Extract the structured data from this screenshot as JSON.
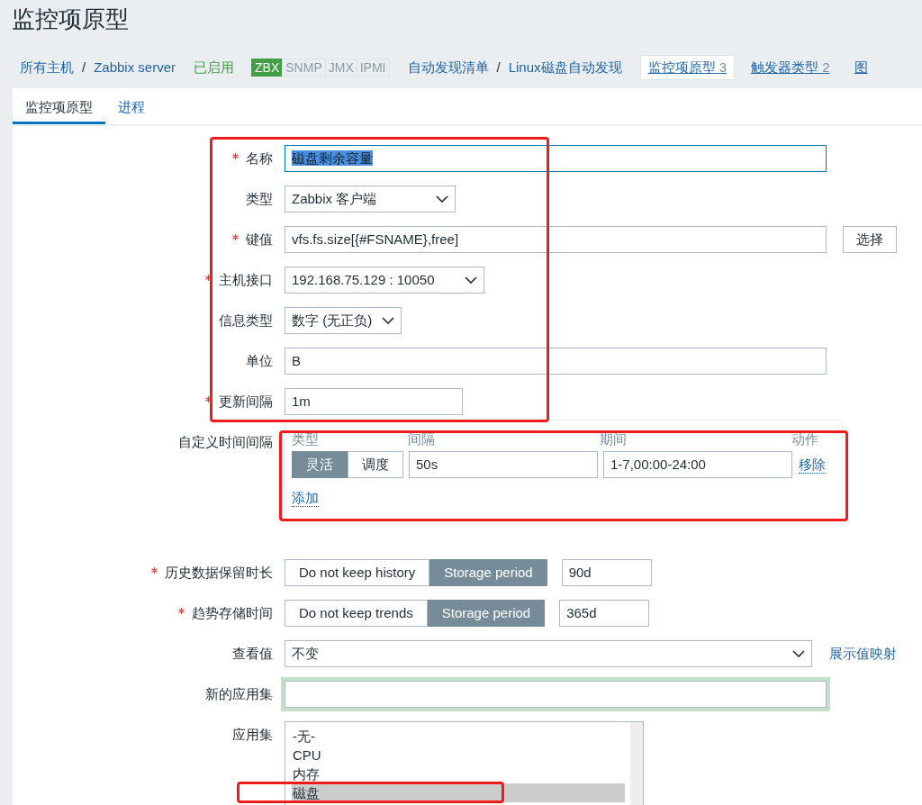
{
  "page_title": "监控项原型",
  "nav": {
    "host_crumbs": {
      "items": [
        {
          "label": "所有主机"
        },
        {
          "label": "Zabbix server"
        }
      ],
      "separator": "/"
    },
    "status": "已启用",
    "availability": [
      {
        "label": "ZBX",
        "on": true
      },
      {
        "label": "SNMP",
        "on": false
      },
      {
        "label": "JMX",
        "on": false
      },
      {
        "label": "IPMI",
        "on": false
      }
    ],
    "discovery_crumbs": {
      "items": [
        {
          "label": "自动发现清单"
        },
        {
          "label": "Linux磁盘自动发现"
        }
      ],
      "separator": "/"
    },
    "tabs": [
      {
        "label": "监控项原型",
        "count": "3",
        "selected": true
      },
      {
        "label": "触发器类型",
        "count": "2",
        "selected": false
      },
      {
        "label": "图",
        "selected": false
      }
    ]
  },
  "form_tabs": [
    {
      "label": "监控项原型",
      "selected": true
    },
    {
      "label": "进程",
      "selected": false
    }
  ],
  "fields": [
    {
      "kind": "text",
      "label": "名称",
      "required": true,
      "value": "磁盘剩余容量",
      "focused": true,
      "text_selected": true
    },
    {
      "kind": "select",
      "label": "类型",
      "required": false,
      "value": "Zabbix 客户端"
    },
    {
      "kind": "text_button",
      "label": "键值",
      "required": true,
      "value": "vfs.fs.size[{#FSNAME},free]",
      "button": "选择"
    },
    {
      "kind": "select",
      "label": "主机接口",
      "required": true,
      "value": "192.168.75.129 : 10050"
    },
    {
      "kind": "select",
      "label": "信息类型",
      "required": false,
      "value": "数字 (无正负)"
    },
    {
      "kind": "text",
      "label": "单位",
      "required": false,
      "value": "B"
    },
    {
      "kind": "text",
      "label": "更新间隔",
      "required": true,
      "value": "1m"
    },
    {
      "kind": "intervals",
      "label": "自定义时间间隔",
      "required": false,
      "columns": [
        "类型",
        "间隔",
        "期间",
        "动作"
      ],
      "rows": [
        {
          "modes": [
            {
              "label": "灵活",
              "selected": true
            },
            {
              "label": "调度",
              "selected": false
            }
          ],
          "interval": "50s",
          "period": "1-7,00:00-24:00",
          "action": "移除"
        }
      ],
      "add": "添加"
    },
    {
      "kind": "storage",
      "label": "历史数据保留时长",
      "required": true,
      "options": [
        {
          "label": "Do not keep history",
          "selected": false
        },
        {
          "label": "Storage period",
          "selected": true
        }
      ],
      "value": "90d"
    },
    {
      "kind": "storage",
      "label": "趋势存储时间",
      "required": true,
      "options": [
        {
          "label": "Do not keep trends",
          "selected": false
        },
        {
          "label": "Storage period",
          "selected": true
        }
      ],
      "value": "365d"
    },
    {
      "kind": "select_link",
      "label": "查看值",
      "required": false,
      "value": "不变",
      "link": "展示值映射"
    },
    {
      "kind": "text",
      "label": "新的应用集",
      "required": false,
      "highlighted": true
    },
    {
      "kind": "listbox",
      "label": "应用集",
      "required": false,
      "options": [
        {
          "label": "-无-",
          "selected": false
        },
        {
          "label": "CPU",
          "selected": false
        },
        {
          "label": "内存",
          "selected": false
        },
        {
          "label": "磁盘",
          "selected": true
        }
      ]
    }
  ]
}
